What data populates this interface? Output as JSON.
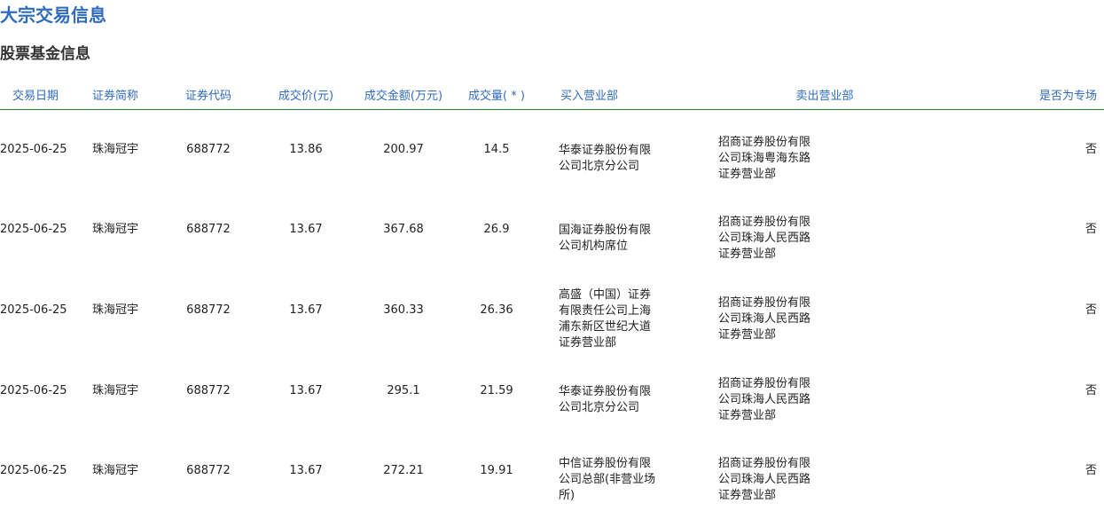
{
  "page": {
    "title": "大宗交易信息",
    "section_title": "股票基金信息"
  },
  "table": {
    "headers": [
      "交易日期",
      "证券简称",
      "证券代码",
      "成交价(元)",
      "成交金额(万元)",
      "成交量( * )",
      "买入营业部",
      "卖出营业部",
      "是否为专场"
    ],
    "rows": [
      {
        "date": "2025-06-25",
        "name": "珠海冠宇",
        "code": "688772",
        "price": "13.86",
        "amount": "200.97",
        "volume": "14.5",
        "buyer": "华泰证券股份有限公司北京分公司",
        "seller": "招商证券股份有限公司珠海粤海东路证券营业部",
        "special": "否"
      },
      {
        "date": "2025-06-25",
        "name": "珠海冠宇",
        "code": "688772",
        "price": "13.67",
        "amount": "367.68",
        "volume": "26.9",
        "buyer": "国海证券股份有限公司机构席位",
        "seller": "招商证券股份有限公司珠海人民西路证券营业部",
        "special": "否"
      },
      {
        "date": "2025-06-25",
        "name": "珠海冠宇",
        "code": "688772",
        "price": "13.67",
        "amount": "360.33",
        "volume": "26.36",
        "buyer": "高盛（中国）证券有限责任公司上海浦东新区世纪大道证券营业部",
        "seller": "招商证券股份有限公司珠海人民西路证券营业部",
        "special": "否"
      },
      {
        "date": "2025-06-25",
        "name": "珠海冠宇",
        "code": "688772",
        "price": "13.67",
        "amount": "295.1",
        "volume": "21.59",
        "buyer": "华泰证券股份有限公司北京分公司",
        "seller": "招商证券股份有限公司珠海人民西路证券营业部",
        "special": "否"
      },
      {
        "date": "2025-06-25",
        "name": "珠海冠宇",
        "code": "688772",
        "price": "13.67",
        "amount": "272.21",
        "volume": "19.91",
        "buyer": "中信证券股份有限公司总部(非营业场所)",
        "seller": "招商证券股份有限公司珠海人民西路证券营业部",
        "special": "否"
      }
    ]
  },
  "colors": {
    "title": "#2f6bbf",
    "header_text": "#2f6bbf",
    "header_rule": "#2e7d32"
  }
}
